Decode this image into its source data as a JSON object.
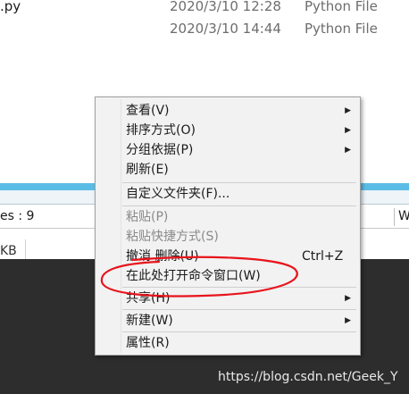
{
  "files": [
    {
      "name": ".py",
      "date": "2020/3/10 12:28",
      "type": "Python File"
    },
    {
      "name": "",
      "date": "2020/3/10 14:44",
      "type": "Python File"
    }
  ],
  "second_window": {
    "status_items": "es : 9",
    "status_right": "W",
    "size_partial": "KB"
  },
  "context_menu": {
    "items": [
      {
        "label": "查看(V)",
        "submenu": true
      },
      {
        "label": "排序方式(O)",
        "submenu": true
      },
      {
        "label": "分组依据(P)",
        "submenu": true
      },
      {
        "label": "刷新(E)"
      },
      {
        "label": "自定义文件夹(F)..."
      },
      {
        "label": "粘贴(P)",
        "disabled": true
      },
      {
        "label": "粘贴快捷方式(S)",
        "disabled": true
      },
      {
        "label": "撤消 删除(U)",
        "shortcut": "Ctrl+Z"
      },
      {
        "label": "在此处打开命令窗口(W)"
      },
      {
        "label": "共享(H)",
        "submenu": true
      },
      {
        "label": "新建(W)",
        "submenu": true
      },
      {
        "label": "属性(R)"
      }
    ],
    "arrow_glyph": "▶"
  },
  "watermark": "https://blog.csdn.net/Geek_Y",
  "colors": {
    "annotation": "#e8141c",
    "accent_bar": "#5bbde6"
  }
}
